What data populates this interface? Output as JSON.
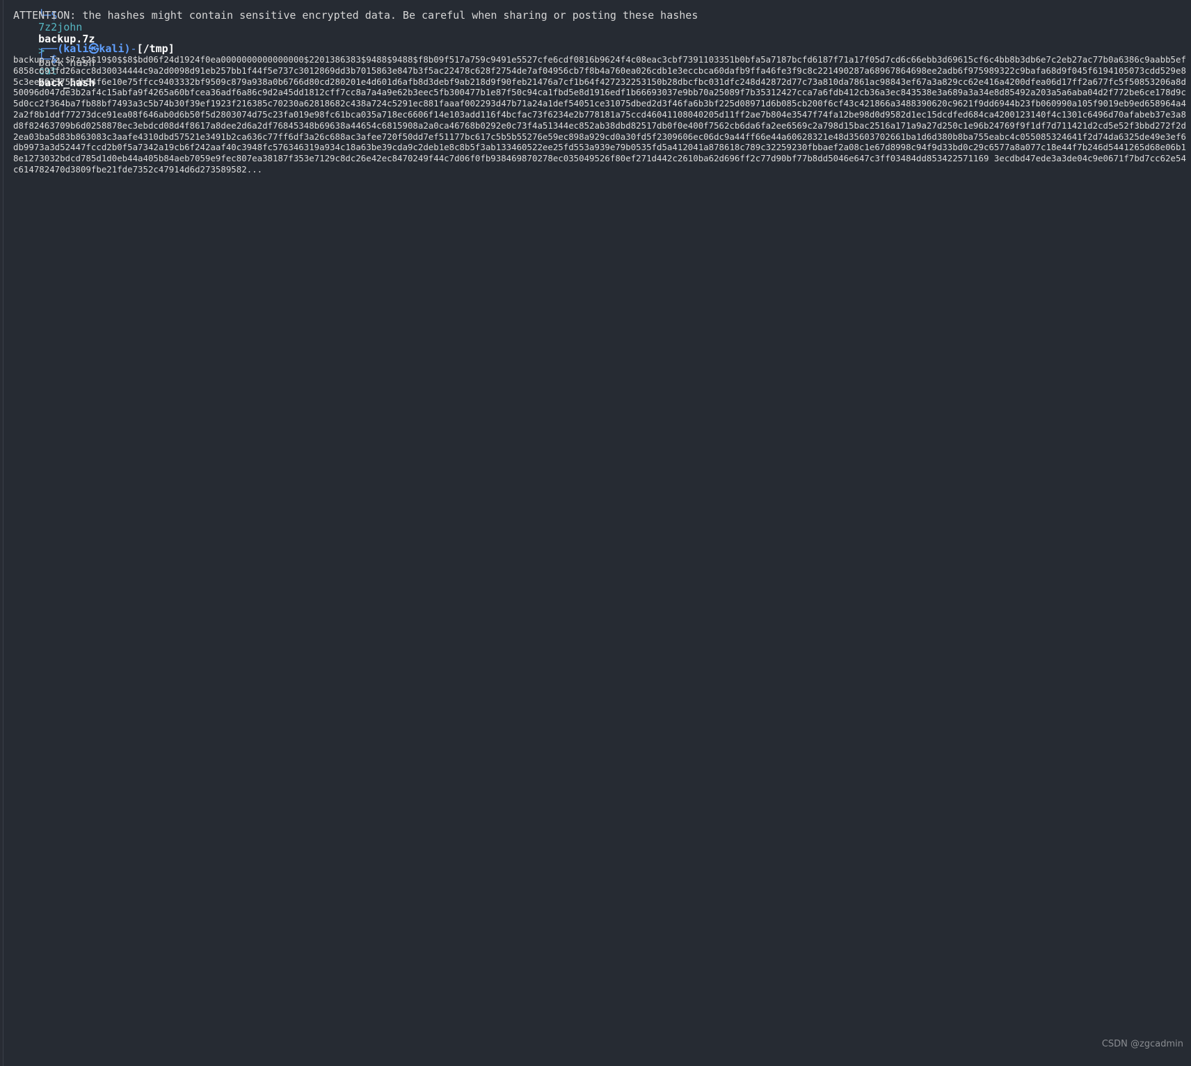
{
  "command1": {
    "prompt_glyph": "└─$",
    "tool": "7z2john",
    "file": "backup.7z",
    "redirect": ">",
    "target": "back_hash"
  },
  "attention_message": "ATTENTION: the hashes might contain sensitive encrypted data. Be careful when sharing or posting these hashes",
  "prompt": {
    "user_host": "(kali㉿kali)",
    "dir": "[/tmp]",
    "open": "┌──",
    "close": "└─$"
  },
  "command2": {
    "tool": "cat",
    "arg": "back_hash"
  },
  "hash_output": "backup.7z:$7z$2$19$0$$8$bd06f24d1924f0ea0000000000000000$2201386383$9488$9488$f8b09f517a759c9491e5527cfe6cdf0816b9624f4c08eac3cbf7391103351b0bfa5a7187bcfd6187f71a17f05d7cd6c66ebb3d69615cf6c4bb8b3db6e7c2eb27ac77b0a6386c9aabb5ef6858c693fd26acc8d30034444c9a2d0098d91eb257bb1f44f5e737c3012869dd3b7015863e847b3f5ac22478c628f2754de7af04956cb7f8b4a760ea026cdb1e3eccbca60dafb9ffa46fe3f9c8c221490287a68967864698ee2adb6f975989322c9bafa68d9f045f6194105073cdd529e85c3ee7633756db54f6e10e75ffcc9403332bf9509c879a938a0b6766d80cd280201e4d601d6afb8d3debf9ab218d9f90feb21476a7cf1b64f427232253150b28dbcfbc031dfc248d42872d77c73a810da7861ac98843ef67a3a829cc62e416a4200dfea06d17ff2a677fc5f50853206a8d50096d047de3b2af4c15abfa9f4265a60bfcea36adf6a86c9d2a45dd1812cff7cc8a7a4a9e62b3eec5fb300477b1e87f50c94ca1fbd5e8d1916edf1b66693037e9bb70a25089f7b35312427cca7a6fdb412cb36a3ec843538e3a689a3a34e8d85492a203a5a6aba04d2f772be6ce178d9c5d0cc2f364ba7fb88bf7493a3c5b74b30f39ef1923f216385c70230a62818682c438a724c5291ec881faaaf002293d47b71a24a1def54051ce31075dbed2d3f46fa6b3bf225d08971d6b085cb200f6cf43c421866a3488390620c9621f9dd6944b23fb060990a105f9019eb9ed658964a42a2f8b1ddf77273dce91ea08f646ab0d6b50f5d2803074d75c23fa019e98fc61bca035a718ec6606f14e103add116f4bcfac73f6234e2b778181a75ccd46041108040205d11ff2ae7b804e3547f74fa12be98d0d9582d1ec15dcdfed684ca4200123140f4c1301c6496d70afabeb37e3a8d8f82463709b6d0258878ec3ebdcd08d4f8617a8dee2d6a2df76845348b69638a44654c6815908a2a0ca46768b0292e0c73f4a51344ec852ab38dbd82517db0f0e400f7562cb6da6fa2ee6569c2a798d15bac2516a171a9a27d250c1e96b24769f9f1df7d711421d2cd5e52f3bbd272f2d2ea03ba5d83b863083c3aafe4310dbd57521e3491b2ca636c77ff6df3a26c688ac3afee720f50dd7ef51177bc617c5b5b55276e59ec898a929cd0a30fd5f2309606ec06dc9a44ff66e44a60628321e48d35603702661ba1d6d380b8ba755eabc4c055085324641f2d74da6325de49e3ef6db9973a3d52447fccd2b0f5a7342a19cb6f242aaf40c3948fc576346319a934c18a63be39cda9c2deb1e8c8b5f3ab133460522ee25fd553a939e79b0535fd5a412041a878618c789c32259230fbbaef2a08c1e67d8998c94f9d33bd0c29c6577a8a077c18e44f7b246d5441265d68e06b18e1273032bdcd785d1d0eb44a405b84aeb7059e9fec807ea38187f353e7129c8dc26e42ec8470249f44c7d06f0fb938469870278ec035049526f80ef271d442c2610ba62d696ff2c77d90bf77b8dd5046e647c3ff03484dd853422571169 3ecdbd47ede3a3de04c9e0671f7bd7cc62e54c614782470d3809fbe21fde7352c47914d6d273589582..."
}
